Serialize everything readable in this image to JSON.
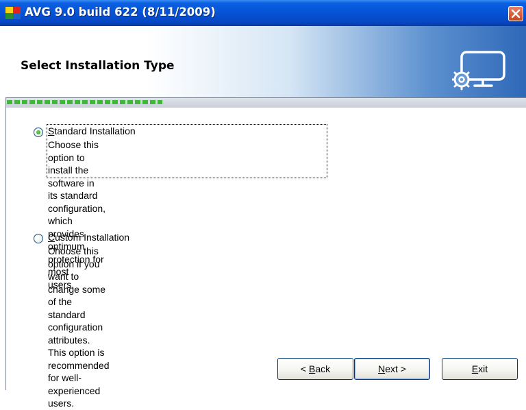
{
  "window": {
    "title": "AVG 9.0 build 622 (8/11/2009)",
    "icons": {
      "app": "avg-logo-icon",
      "close": "close-icon"
    }
  },
  "header": {
    "title": "Select Installation Type",
    "icon": "monitor-gear-icon"
  },
  "progress": {
    "completed_fraction": 0.3
  },
  "options": [
    {
      "id": "standard",
      "mnemonic": "S",
      "label_rest": "tandard Installation",
      "description_lines": [
        "Choose this option to install the software in its standard",
        "configuration, which provides optimum protection for most",
        "users."
      ],
      "selected": true
    },
    {
      "id": "custom",
      "mnemonic": "C",
      "label_rest": "ustom Installation",
      "description_lines": [
        "Choose this option if you want to change some of the",
        "standard configuration attributes. This option is",
        "recommended for well-experienced users."
      ],
      "selected": false
    }
  ],
  "buttons": {
    "back": {
      "prefix": "< ",
      "mnemonic": "B",
      "rest": "ack"
    },
    "next": {
      "mnemonic": "N",
      "rest": "ext >"
    },
    "exit": {
      "mnemonic": "E",
      "rest": "xit"
    }
  },
  "colors": {
    "accent_green": "#3fb83a",
    "titlebar_blue": "#0653d6",
    "close_red": "#c8451d"
  }
}
